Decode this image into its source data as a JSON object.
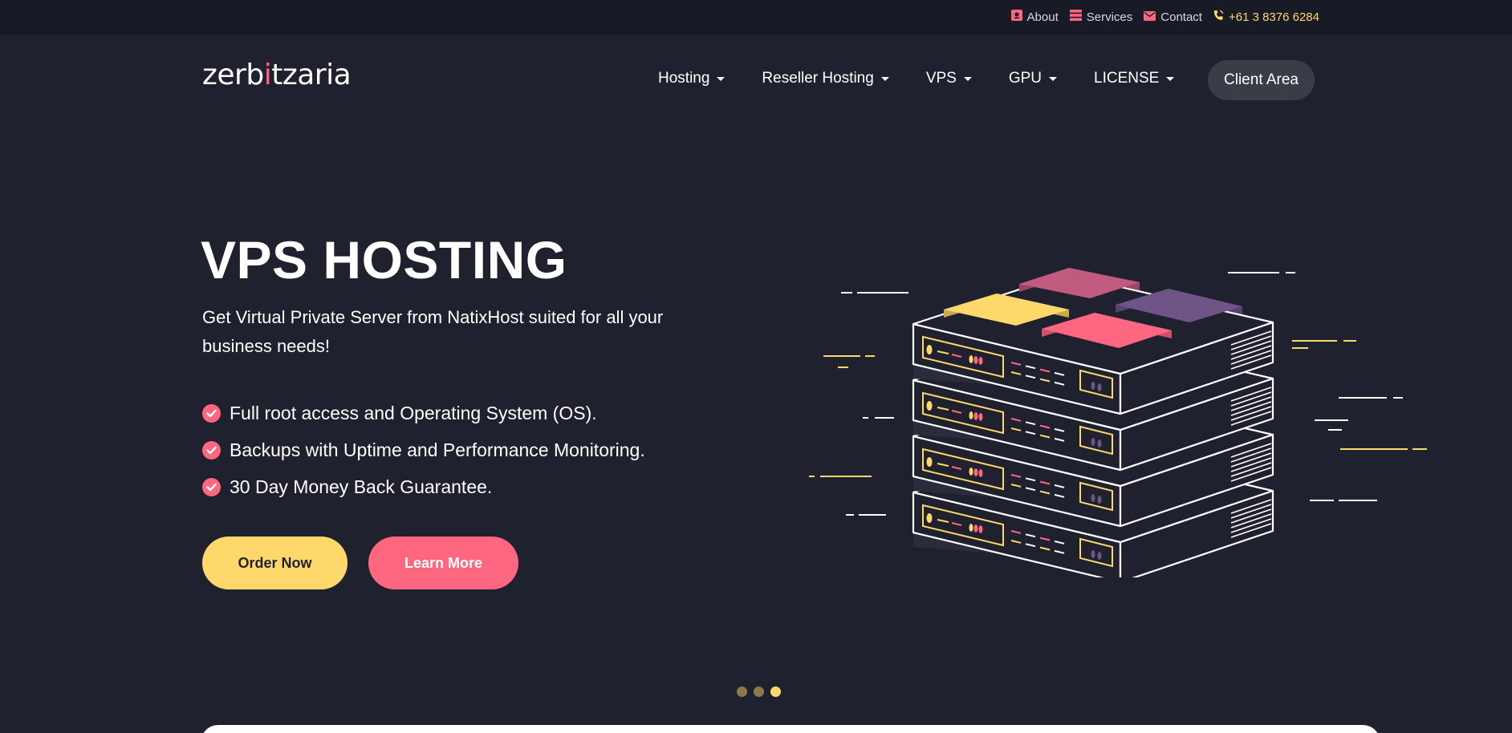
{
  "topbar": {
    "links": [
      {
        "label": "About",
        "icon": "about-icon"
      },
      {
        "label": "Services",
        "icon": "server-icon"
      },
      {
        "label": "Contact",
        "icon": "mail-icon"
      }
    ],
    "phone": {
      "label": "+61 3 8376 6284",
      "icon": "phone-icon"
    }
  },
  "logo": {
    "text_before": "zerb",
    "text_i": "i",
    "text_after": "tzaria"
  },
  "nav": {
    "items": [
      {
        "label": "Hosting"
      },
      {
        "label": "Reseller Hosting"
      },
      {
        "label": "VPS"
      },
      {
        "label": "GPU"
      },
      {
        "label": "LICENSE"
      }
    ],
    "client_area_label": "Client Area"
  },
  "hero": {
    "title": "VPS HOSTING",
    "subtitle": "Get Virtual Private Server from NatixHost suited for all your business needs!",
    "features": [
      "Full root access and Operating System (OS).",
      "Backups with Uptime and Performance Monitoring.",
      "30 Day Money Back Guarantee."
    ],
    "order_label": "Order Now",
    "learn_label": "Learn More"
  },
  "slider": {
    "count": 3,
    "active_index": 3
  },
  "colors": {
    "background": "#1f212e",
    "topbar": "#181a26",
    "accent_yellow": "#ffd86b",
    "accent_pink": "#ff6680",
    "purple": "#6f5587",
    "mauve": "#c05a7e"
  }
}
